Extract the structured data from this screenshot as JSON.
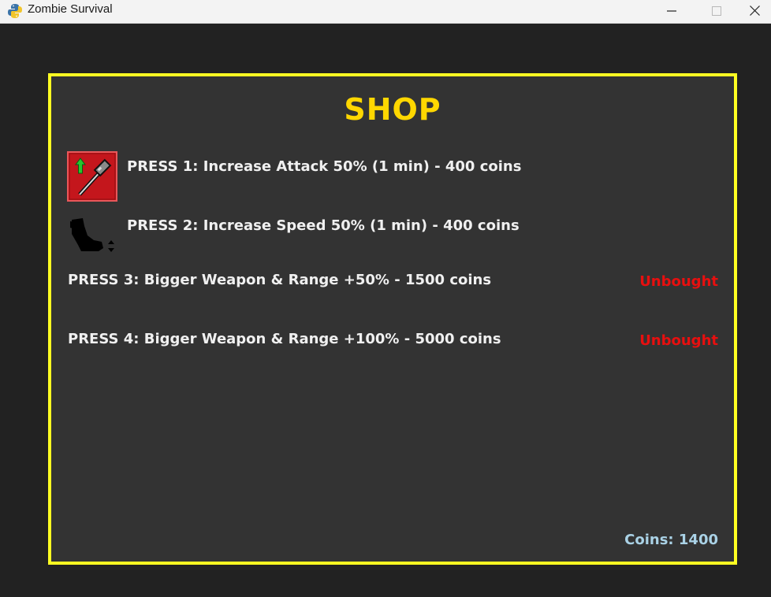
{
  "window": {
    "title": "Zombie Survival",
    "icons": {
      "app": "python-snake-icon",
      "minimize": "minimize-icon",
      "maximize": "maximize-icon",
      "close": "close-icon"
    }
  },
  "shop": {
    "title": "SHOP",
    "items": [
      {
        "label": "PRESS 1: Increase Attack 50% (1 min) - 400 coins",
        "icon": "attack-boost-hammer-icon"
      },
      {
        "label": "PRESS 2: Increase Speed 50% (1 min) - 400 coins",
        "icon": "speed-boot-icon"
      },
      {
        "label": "PRESS 3: Bigger Weapon & Range +50% - 1500 coins",
        "status": "Unbought"
      },
      {
        "label": "PRESS 4: Bigger Weapon & Range +100% - 5000 coins",
        "status": "Unbought"
      }
    ],
    "coins_label": "Coins: 1400"
  },
  "colors": {
    "border": "#ffff22",
    "title": "#ffd700",
    "status_unbought": "#e80f0f",
    "coins": "#aad2e6",
    "panel_bg": "#333333"
  }
}
